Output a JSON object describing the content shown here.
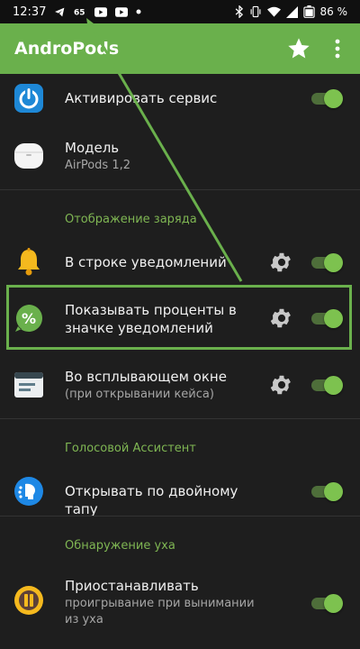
{
  "status_bar": {
    "time": "12:37",
    "left_icons": [
      "telegram-icon",
      "vk-icon",
      "youtube-icon",
      "youtube-icon",
      "dot-icon"
    ],
    "right_icons": [
      "bluetooth-icon",
      "vibrate-icon",
      "wifi-icon",
      "signal-icon",
      "battery-icon"
    ],
    "battery": "86 %"
  },
  "app_bar": {
    "title": "AndroPods",
    "actions": [
      "star-icon",
      "more-vert-icon"
    ],
    "color": "#6ab04c"
  },
  "items": [
    {
      "title": "Активировать сервис",
      "subtitle": "",
      "icon": "power-icon",
      "has_settings": false,
      "toggle_on": true
    },
    {
      "title": "Модель",
      "subtitle": "AirPods 1,2",
      "icon": "airpods-case-icon",
      "has_settings": false,
      "toggle": false
    }
  ],
  "sections": [
    {
      "header": "Отображение заряда",
      "items": [
        {
          "title": "В строке уведомлений",
          "subtitle": "",
          "icon": "bell-icon",
          "has_settings": true,
          "toggle_on": true
        },
        {
          "title": "Показывать проценты в значке уведомлений",
          "subtitle": "",
          "icon": "percent-badge-icon",
          "has_settings": true,
          "toggle_on": true,
          "highlighted": true
        },
        {
          "title": "Во всплывающем окне",
          "subtitle": "(при открывании кейса)",
          "icon": "popup-window-icon",
          "has_settings": true,
          "toggle_on": true
        }
      ]
    },
    {
      "header": "Голосовой Ассистент",
      "items": [
        {
          "title": "Открывать по двойному тапу",
          "subtitle": "",
          "icon": "voice-assistant-icon",
          "has_settings": false,
          "toggle_on": true
        }
      ]
    },
    {
      "header": "Обнаружение уха",
      "items": [
        {
          "title": "Приостанавливать",
          "subtitle": "проигрывание при вынимании из уха",
          "icon": "pause-icon",
          "has_settings": false,
          "toggle_on": true
        }
      ]
    }
  ],
  "colors": {
    "accent": "#6ab04c",
    "background": "#1e1e1e",
    "section_header": "#7fb653"
  }
}
